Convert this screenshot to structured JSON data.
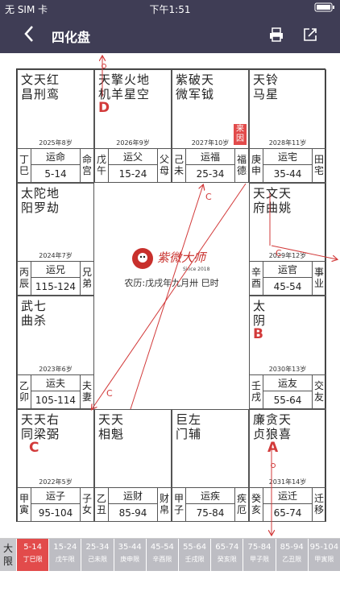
{
  "status": {
    "carrier": "无 SIM 卡",
    "time": "下午1:51",
    "battery": "■"
  },
  "header": {
    "back_icon": "chevron-left-icon",
    "title": "四化盘",
    "print_icon": "printer-icon",
    "share_icon": "share-icon"
  },
  "palaces": [
    {
      "id": "si",
      "stars": [
        "文天红",
        "昌刑鸾"
      ],
      "age": "2025年8岁",
      "gz": "丁巳",
      "yun": "运命",
      "range": "5-14",
      "pal": "命宫"
    },
    {
      "id": "wu",
      "stars": [
        "天擎火地",
        "机羊星空"
      ],
      "mark": "D",
      "age": "2026年9岁",
      "gz": "戊午",
      "yun": "运父",
      "range": "15-24",
      "pal": "父母"
    },
    {
      "id": "wei",
      "stars": [
        "紫破天",
        "微军钺"
      ],
      "laiyin": "来因",
      "age": "2027年10岁",
      "gz": "己未",
      "yun": "运福",
      "range": "25-34",
      "pal": "福德"
    },
    {
      "id": "shen",
      "stars": [
        "天铃",
        "马星"
      ],
      "age": "2028年11岁",
      "gz": "庚申",
      "yun": "运宅",
      "range": "35-44",
      "pal": "田宅"
    },
    {
      "id": "chen",
      "stars": [
        "太陀地",
        "阳罗劫"
      ],
      "age": "2024年7岁",
      "gz": "丙辰",
      "yun": "运兄",
      "range": "115-124",
      "pal": "兄弟"
    },
    {
      "id": "you",
      "stars": [
        "天文天",
        "府曲姚"
      ],
      "age": "2029年12岁",
      "gz": "辛酉",
      "yun": "运官",
      "range": "45-54",
      "pal": "事业"
    },
    {
      "id": "mao",
      "stars": [
        "武七",
        "曲杀"
      ],
      "age": "2023年6岁",
      "gz": "乙卯",
      "yun": "运夫",
      "range": "105-114",
      "pal": "夫妻"
    },
    {
      "id": "xu",
      "stars": [
        "太",
        "阴"
      ],
      "mark": "B",
      "age": "2030年13岁",
      "gz": "壬戌",
      "yun": "运友",
      "range": "55-64",
      "pal": "交友"
    },
    {
      "id": "yin",
      "stars": [
        "天天右",
        "同梁弼"
      ],
      "mark": "C",
      "age": "2022年5岁",
      "gz": "甲寅",
      "yun": "运子",
      "range": "95-104",
      "pal": "子女"
    },
    {
      "id": "chou",
      "stars": [
        "天天",
        "相魁"
      ],
      "age": "",
      "gz": "乙丑",
      "yun": "运财",
      "range": "85-94",
      "pal": "财帛"
    },
    {
      "id": "zi",
      "stars": [
        "巨左",
        "门辅"
      ],
      "age": "",
      "gz": "甲子",
      "yun": "运疾",
      "range": "75-84",
      "pal": "疾厄"
    },
    {
      "id": "hai",
      "stars": [
        "廉贪天",
        "贞狼喜"
      ],
      "mark": "A",
      "age": "2031年14岁",
      "gz": "癸亥",
      "yun": "运迁",
      "range": "65-74",
      "pal": "迁移"
    }
  ],
  "center": {
    "logo": "紫微大师",
    "logo_sub": "Since 2018",
    "lunar": "农历:戊戌年九月卅  巳时"
  },
  "arrow_labels": {
    "c": "C"
  },
  "tabs": {
    "label": "大限",
    "items": [
      {
        "r1": "5-14",
        "r2": "丁巳限",
        "active": true
      },
      {
        "r1": "15-24",
        "r2": "戊午限"
      },
      {
        "r1": "25-34",
        "r2": "己未限"
      },
      {
        "r1": "35-44",
        "r2": "庚申限"
      },
      {
        "r1": "45-54",
        "r2": "辛酉限"
      },
      {
        "r1": "55-64",
        "r2": "壬戌限"
      },
      {
        "r1": "65-74",
        "r2": "癸亥限"
      },
      {
        "r1": "75-84",
        "r2": "甲子限"
      },
      {
        "r1": "85-94",
        "r2": "乙丑限"
      },
      {
        "r1": "95-104",
        "r2": "甲寅限"
      }
    ]
  },
  "colors": {
    "header_bg": "#3f3d55",
    "accent": "#e24b4b",
    "tab_bg": "#bdbdc3"
  }
}
